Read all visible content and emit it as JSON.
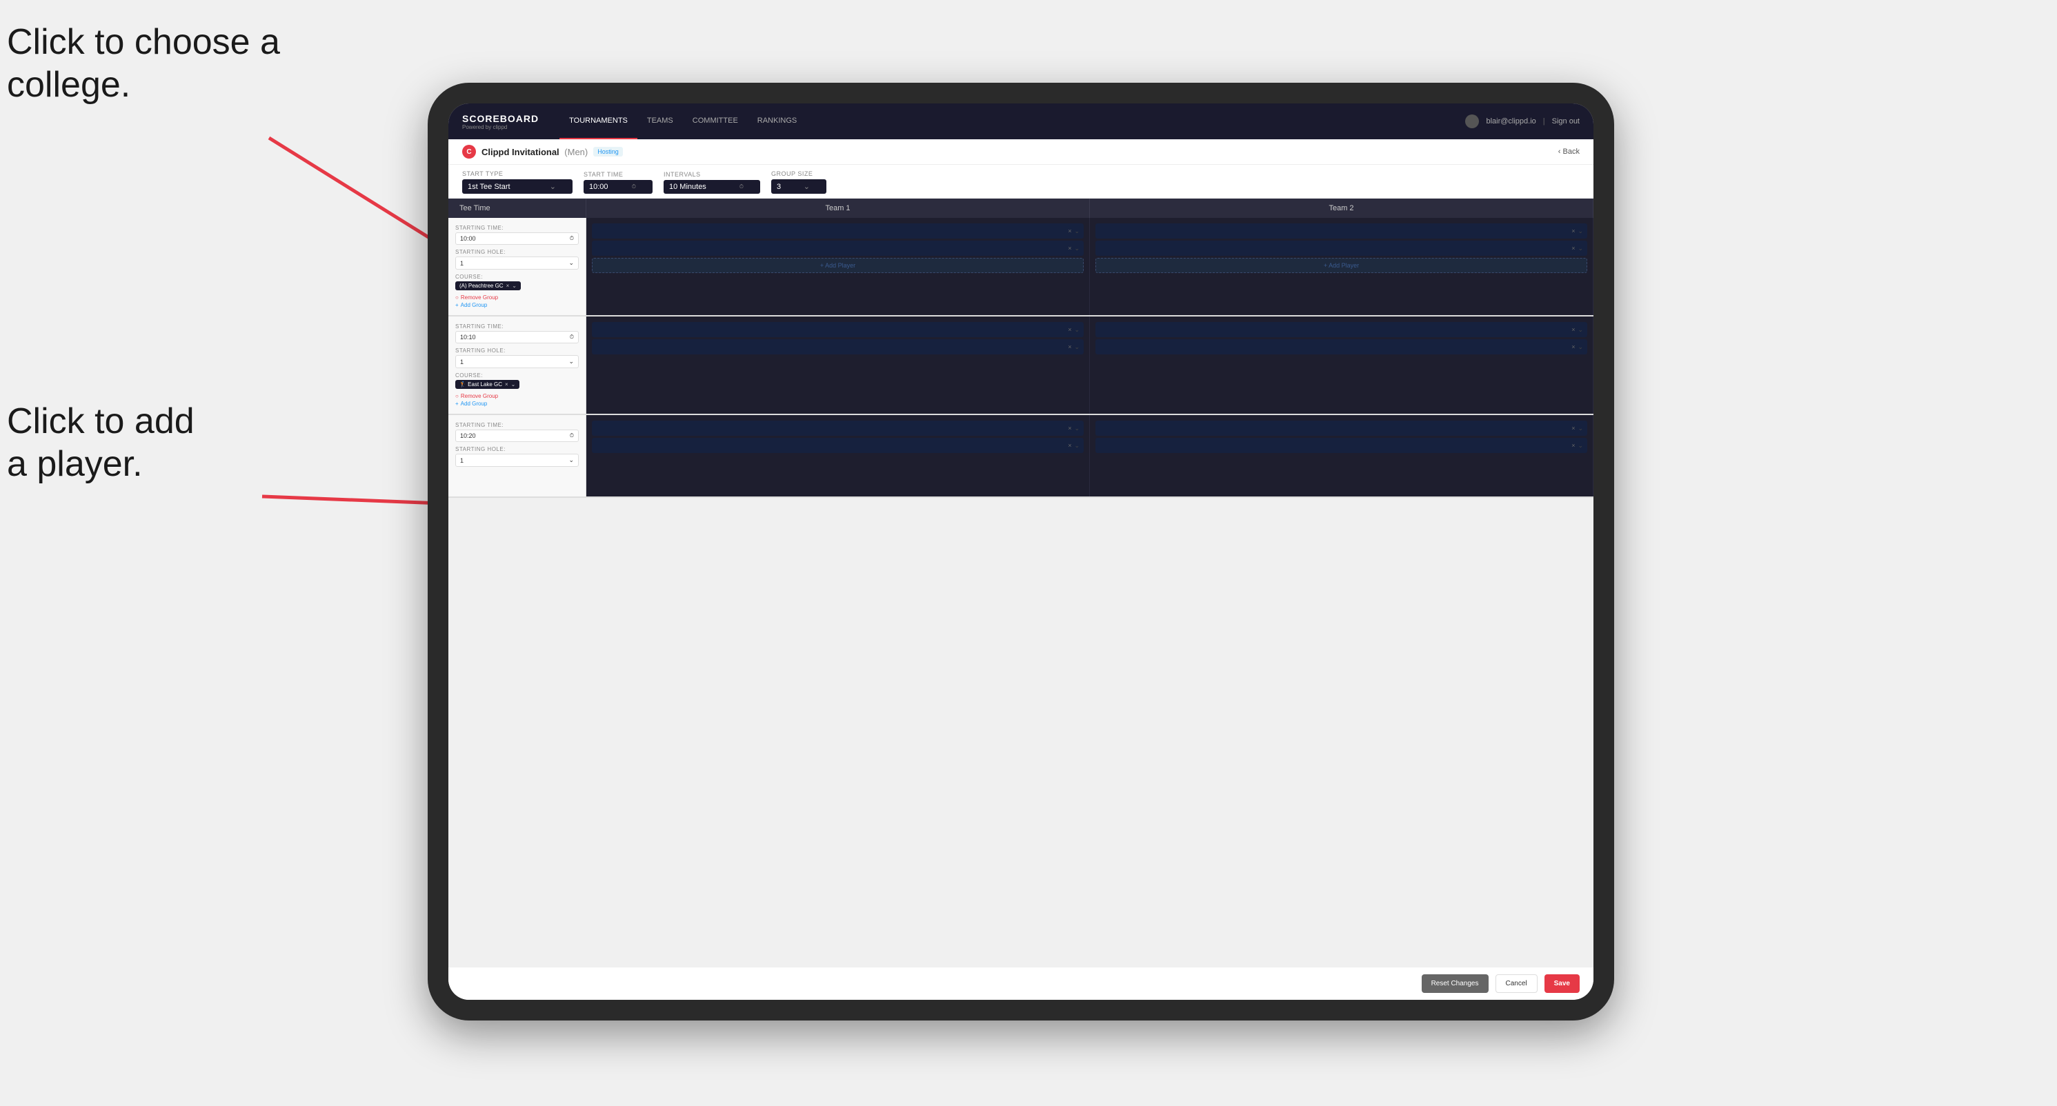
{
  "annotations": {
    "top_text_line1": "Click to choose a",
    "top_text_line2": "college.",
    "bottom_text_line1": "Click to add",
    "bottom_text_line2": "a player."
  },
  "nav": {
    "brand_title": "SCOREBOARD",
    "brand_sub": "Powered by clippd",
    "links": [
      {
        "label": "TOURNAMENTS",
        "active": true
      },
      {
        "label": "TEAMS",
        "active": false
      },
      {
        "label": "COMMITTEE",
        "active": false
      },
      {
        "label": "RANKINGS",
        "active": false
      }
    ],
    "user_email": "blair@clippd.io",
    "sign_out": "Sign out"
  },
  "sub_header": {
    "tournament_name": "Clippd Invitational",
    "gender": "(Men)",
    "hosting": "Hosting",
    "back": "Back"
  },
  "controls": {
    "start_type_label": "Start Type",
    "start_type_value": "1st Tee Start",
    "start_time_label": "Start Time",
    "start_time_value": "10:00",
    "intervals_label": "Intervals",
    "intervals_value": "10 Minutes",
    "group_size_label": "Group Size",
    "group_size_value": "3"
  },
  "table": {
    "col1": "Tee Time",
    "col2": "Team 1",
    "col3": "Team 2"
  },
  "groups": [
    {
      "starting_time": "10:00",
      "starting_hole": "1",
      "course": "(A) Peachtree GC",
      "team1_players": 2,
      "team2_players": 2
    },
    {
      "starting_time": "10:10",
      "starting_hole": "1",
      "course": "East Lake GC",
      "team1_players": 2,
      "team2_players": 2
    },
    {
      "starting_time": "10:20",
      "starting_hole": "1",
      "course": "",
      "team1_players": 2,
      "team2_players": 2
    }
  ],
  "footer": {
    "reset_label": "Reset Changes",
    "cancel_label": "Cancel",
    "save_label": "Save"
  }
}
